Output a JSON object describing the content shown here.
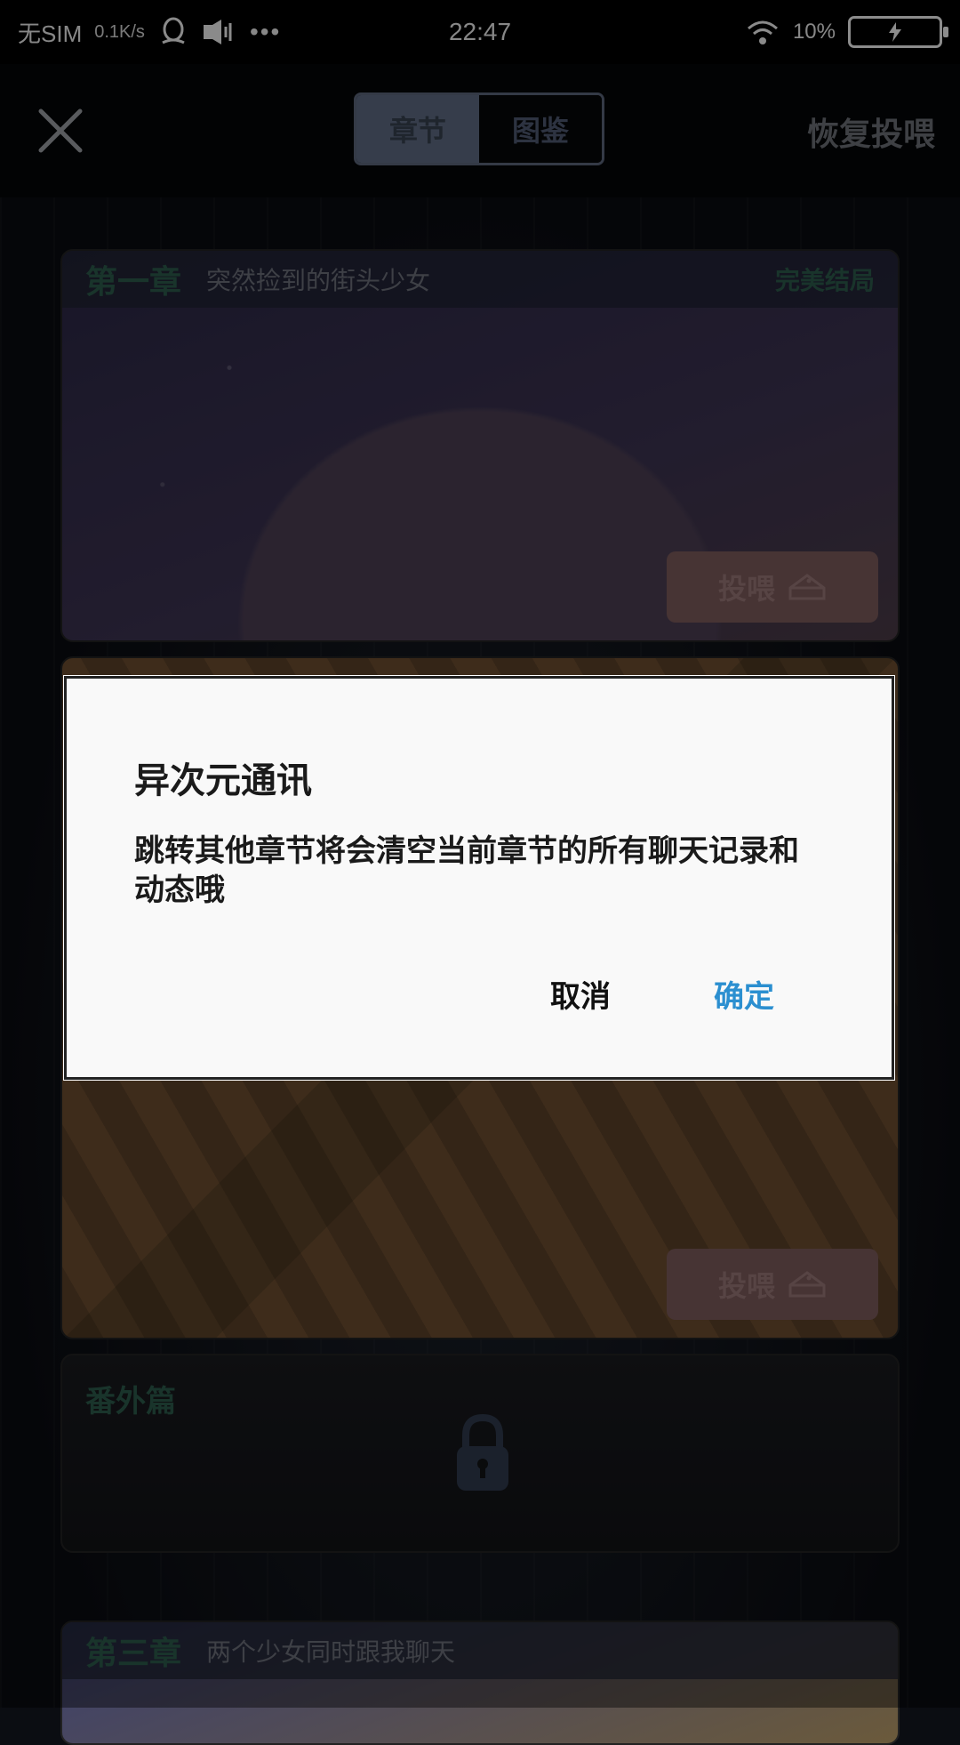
{
  "status_bar": {
    "carrier": "无SIM",
    "speed": "0.1K/s",
    "more_dots": "•••",
    "time": "22:47",
    "battery_percent": "10%"
  },
  "header": {
    "tabs": [
      "章节",
      "图鉴"
    ],
    "active_tab": "章节",
    "restore_label": "恢复投喂"
  },
  "chapters": [
    {
      "number": "第一章",
      "title": "突然捡到的街头少女",
      "status": "完美结局",
      "feed_label": "投喂"
    },
    {
      "feed_label": "投喂"
    },
    {
      "number": "番外篇",
      "locked": true
    },
    {
      "number": "第三章",
      "title": "两个少女同时跟我聊天"
    }
  ],
  "dialog": {
    "title": "异次元通讯",
    "message": "跳转其他章节将会清空当前章节的所有聊天记录和动态哦",
    "cancel_label": "取消",
    "confirm_label": "确定"
  },
  "colors": {
    "confirm_accent": "#2b8fd0",
    "chapter_label": "#2c5a4a",
    "feed_button": "#7a5a5b"
  }
}
